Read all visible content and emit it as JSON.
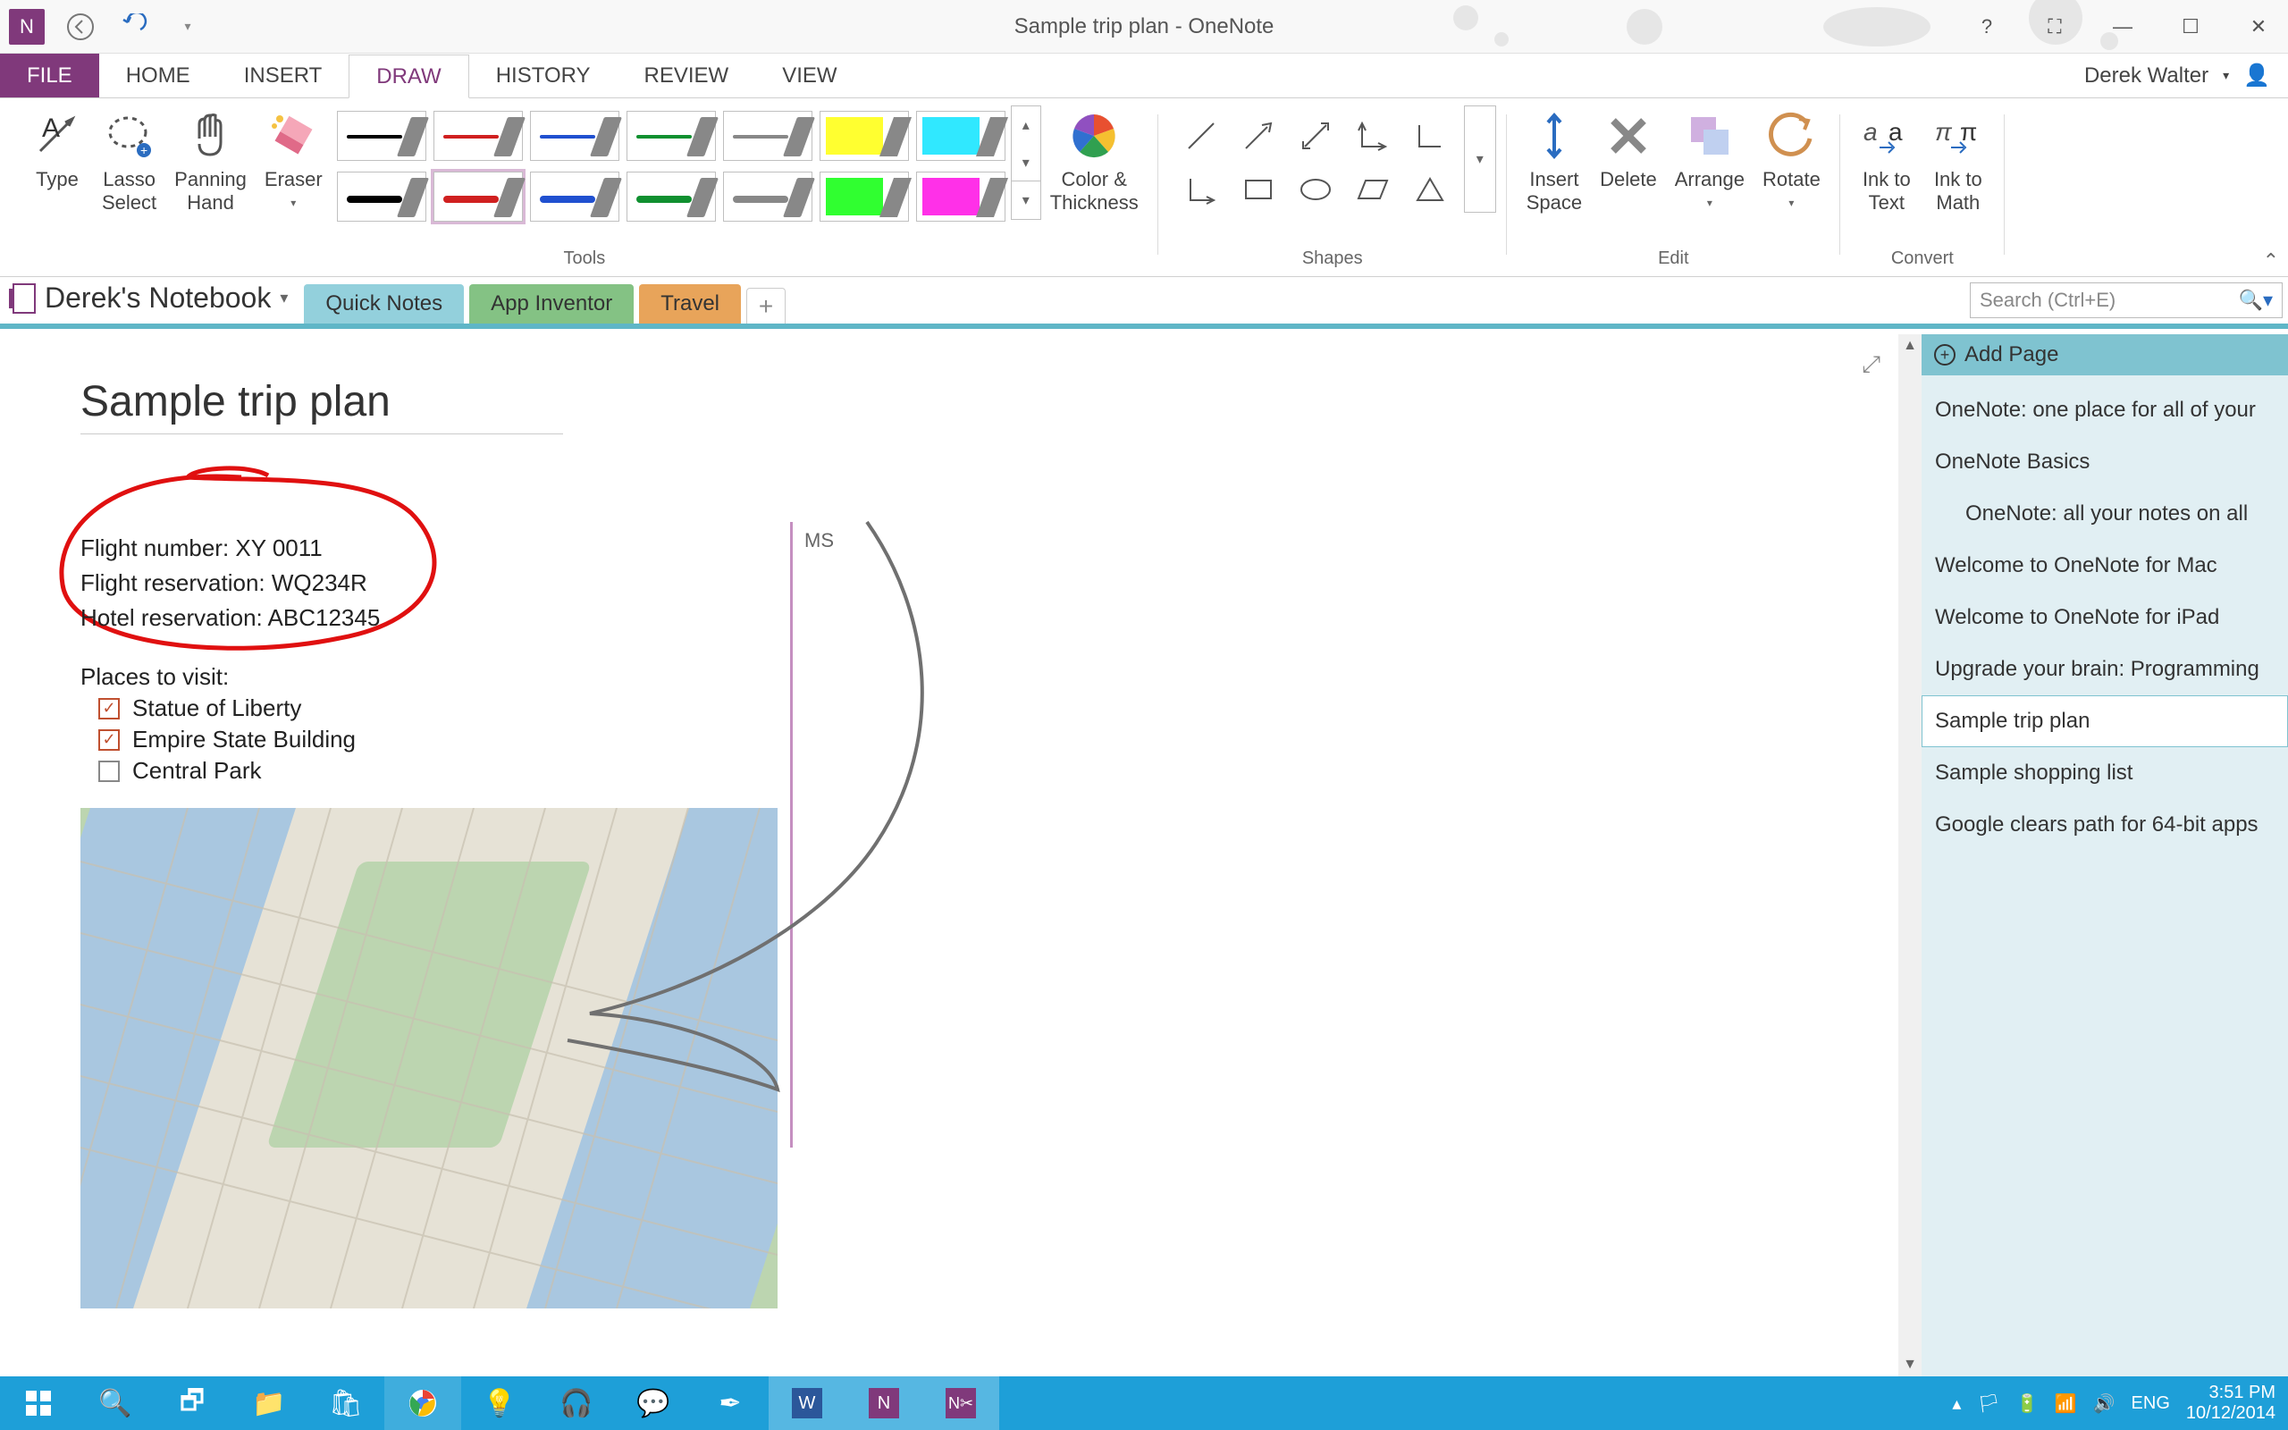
{
  "title": "Sample trip plan - OneNote",
  "user": "Derek Walter",
  "ribbon": {
    "tabs": [
      "FILE",
      "HOME",
      "INSERT",
      "DRAW",
      "HISTORY",
      "REVIEW",
      "VIEW"
    ],
    "active": "DRAW",
    "groups": {
      "tools": "Tools",
      "shapes": "Shapes",
      "edit": "Edit",
      "convert": "Convert"
    },
    "buttons": {
      "type": "Type",
      "lasso": "Lasso\nSelect",
      "panning": "Panning\nHand",
      "eraser": "Eraser",
      "color": "Color &\nThickness",
      "insert_space": "Insert\nSpace",
      "delete": "Delete",
      "arrange": "Arrange",
      "rotate": "Rotate",
      "ink_text": "Ink to\nText",
      "ink_math": "Ink to\nMath"
    }
  },
  "notebook": {
    "name": "Derek's Notebook",
    "sections": [
      "Quick Notes",
      "App Inventor",
      "Travel"
    ]
  },
  "search_placeholder": "Search (Ctrl+E)",
  "page": {
    "title": "Sample trip plan",
    "flight_number": "Flight number: XY 0011",
    "flight_reservation": "Flight reservation: WQ234R",
    "hotel_reservation": "Hotel reservation: ABC12345",
    "places_label": "Places to visit:",
    "places": [
      {
        "label": "Statue of Liberty",
        "checked": true
      },
      {
        "label": "Empire State Building",
        "checked": true
      },
      {
        "label": "Central Park",
        "checked": false
      }
    ],
    "annotation": "MS"
  },
  "add_page": "Add Page",
  "pages": [
    {
      "title": "OneNote: one place for all of your"
    },
    {
      "title": "OneNote Basics"
    },
    {
      "title": "OneNote: all your notes on all",
      "indent": true
    },
    {
      "title": "Welcome to OneNote for Mac"
    },
    {
      "title": "Welcome to OneNote for iPad"
    },
    {
      "title": "Upgrade your brain: Programming"
    },
    {
      "title": "Sample trip plan",
      "selected": true
    },
    {
      "title": "Sample shopping list"
    },
    {
      "title": "Google clears path for 64-bit apps"
    }
  ],
  "tray": {
    "lang": "ENG",
    "time": "3:51 PM",
    "date": "10/12/2014"
  }
}
